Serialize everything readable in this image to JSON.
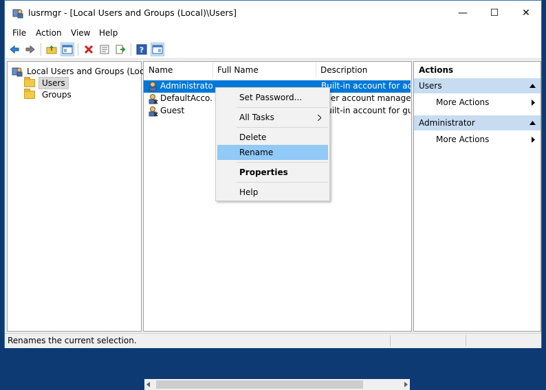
{
  "window": {
    "title": "lusrmgr - [Local Users and Groups (Local)\\Users]",
    "minimize": "—",
    "maximize": "☐",
    "close": "✕"
  },
  "menu": [
    "File",
    "Action",
    "View",
    "Help"
  ],
  "toolbar": {
    "icons": [
      "back-arrow-icon",
      "forward-arrow-icon",
      "up-folder-icon",
      "show-hide-tree-icon",
      "delete-icon",
      "properties-icon",
      "export-list-icon",
      "help-icon",
      "show-hide-action-pane-icon"
    ]
  },
  "tree": {
    "root": "Local Users and Groups (Local)",
    "items": [
      "Users",
      "Groups"
    ],
    "selected": "Users"
  },
  "list": {
    "columns": [
      "Name",
      "Full Name",
      "Description"
    ],
    "rows": [
      {
        "name": "Administrator",
        "full_name": "",
        "description": "Built-in account for adm"
      },
      {
        "name": "DefaultAcco...",
        "full_name": "",
        "description": "user account managed"
      },
      {
        "name": "Guest",
        "full_name": "",
        "description": "Built-in account for gues"
      }
    ],
    "selected_row": 0
  },
  "context_menu": {
    "items": [
      {
        "label": "Set Password...",
        "bold": false,
        "highlighted": false,
        "submenu": false
      },
      {
        "label": "All Tasks",
        "bold": false,
        "highlighted": false,
        "submenu": true
      },
      {
        "label": "Delete",
        "bold": false,
        "highlighted": false,
        "submenu": false
      },
      {
        "label": "Rename",
        "bold": false,
        "highlighted": true,
        "submenu": false
      },
      {
        "label": "Properties",
        "bold": true,
        "highlighted": false,
        "submenu": false
      },
      {
        "label": "Help",
        "bold": false,
        "highlighted": false,
        "submenu": false
      }
    ]
  },
  "actions": {
    "title": "Actions",
    "sections": [
      {
        "header": "Users",
        "items": [
          "More Actions"
        ]
      },
      {
        "header": "Administrator",
        "items": [
          "More Actions"
        ]
      }
    ]
  },
  "status": {
    "text": "Renames the current selection."
  },
  "colors": {
    "selection": "#0078d7",
    "context_highlight": "#91c9f7",
    "action_header": "#c7dcf1",
    "desktop": "#0d3a73"
  }
}
